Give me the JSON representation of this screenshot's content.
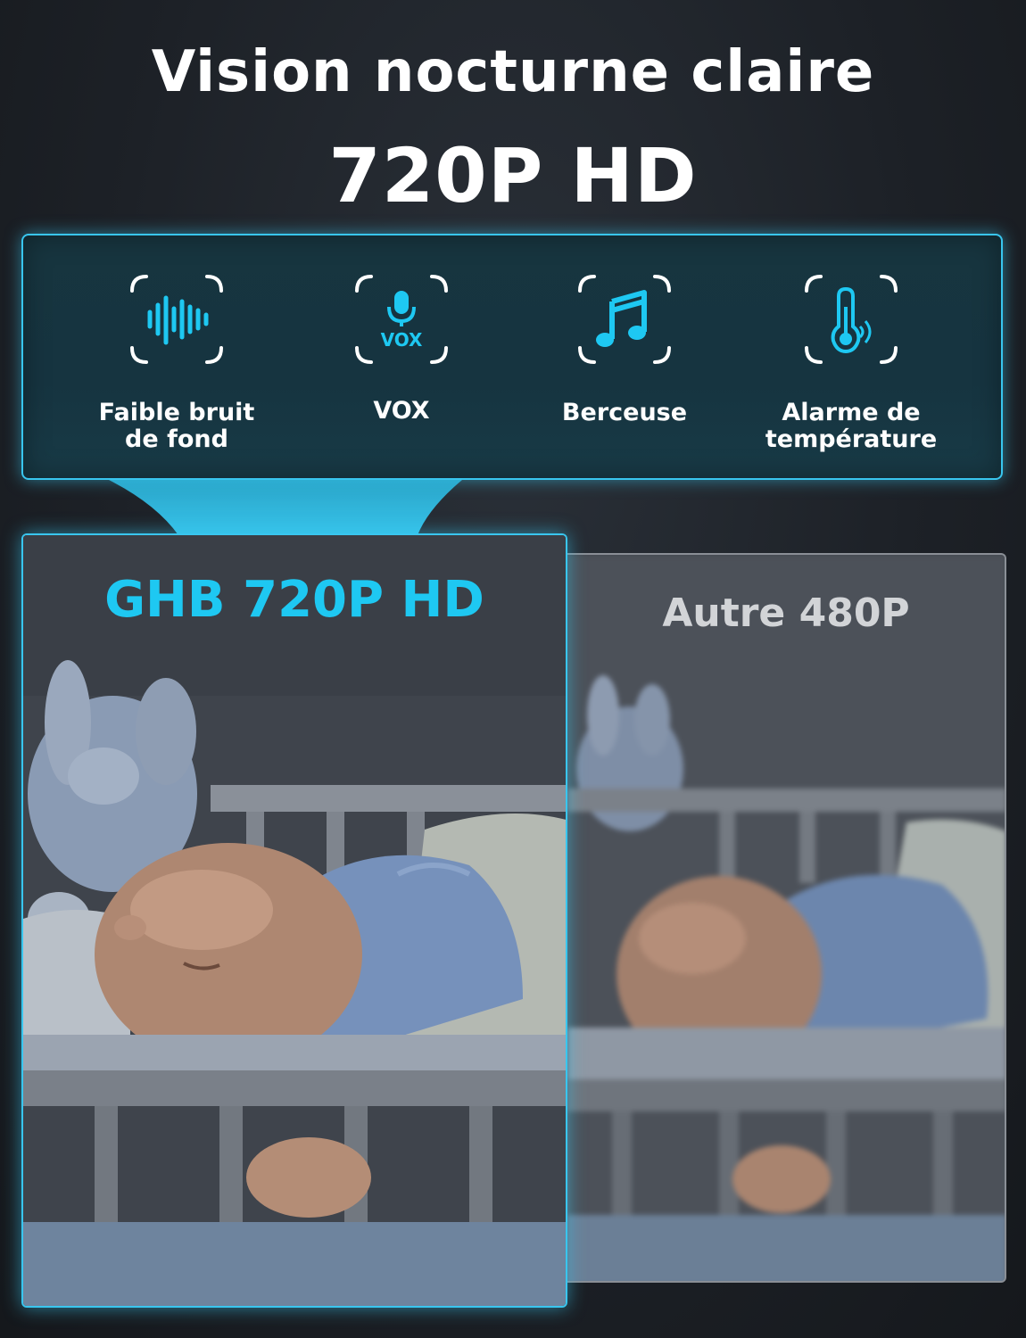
{
  "headline": {
    "line1": "Vision nocturne claire",
    "line2": "720P HD"
  },
  "features": [
    {
      "icon": "sound-wave-icon",
      "label_line1": "Faible bruit",
      "label_line2": "de fond"
    },
    {
      "icon": "microphone-vox-icon",
      "icon_text": "VOX",
      "label_line1": "VOX",
      "label_line2": ""
    },
    {
      "icon": "music-note-icon",
      "label_line1": "Berceuse",
      "label_line2": ""
    },
    {
      "icon": "thermometer-icon",
      "label_line1": "Alarme de",
      "label_line2": "température"
    }
  ],
  "comparison": {
    "left_title": "GHB 720P HD",
    "right_title": "Autre 480P"
  },
  "colors": {
    "accent": "#1ec8f2",
    "panel_border": "#39c6ef",
    "background": "#1d2127"
  }
}
